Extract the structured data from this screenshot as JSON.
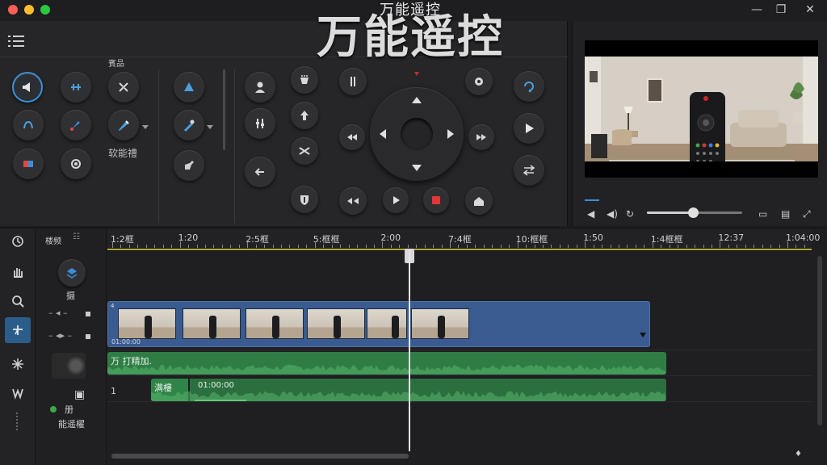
{
  "window": {
    "small_title": "万能遥控",
    "big_title": "万能遥控",
    "minimize_glyph": "—",
    "maximize_glyph": "❐",
    "close_glyph": "✕"
  },
  "control_panel": {
    "group_label_top": "賓品",
    "group_label_mid": "软能禮",
    "icons": [
      "megaphone-icon",
      "fan-icon",
      "connect-icon",
      "draw-icon",
      "brush-icon",
      "pen-icon",
      "battery-icon",
      "gear-icon",
      "triangle-up-icon",
      "pipette-icon",
      "stamp-icon",
      "user-icon",
      "mixer-icon",
      "arrow-up-icon",
      "shuffle-icon",
      "back-arrow-icon",
      "cup-icon",
      "pause-icon",
      "rewind-icon",
      "forward-icon",
      "play-icon",
      "stop-icon",
      "home-icon",
      "settings-icon",
      "refresh-icon",
      "swap-icon"
    ]
  },
  "preview": {
    "controls": [
      "prev-icon",
      "volume-icon",
      "loop-icon",
      "fit-icon",
      "subtitle-icon",
      "fullscreen-icon"
    ],
    "volume_level": 0.48
  },
  "timeline": {
    "header_label": "楼频",
    "track_labels": {
      "video_track": "摄",
      "audio_track_number": "1",
      "footer_line1": "册",
      "footer_line2": "能遥櫂"
    },
    "ticks": [
      "1:2框",
      "1:20",
      "2:5框",
      "5:框框",
      "2:00",
      "7:4框",
      "10:框框",
      "1:50",
      "1:4框框",
      "12:37",
      "1:04:00"
    ],
    "video_clip": {
      "name": "4",
      "caption": "01:00:00"
    },
    "audio_clip_main": {
      "label": "万 打精加."
    },
    "audio_clip_sub": {
      "label_a": "满樓",
      "label_b": "01:00:00"
    }
  }
}
